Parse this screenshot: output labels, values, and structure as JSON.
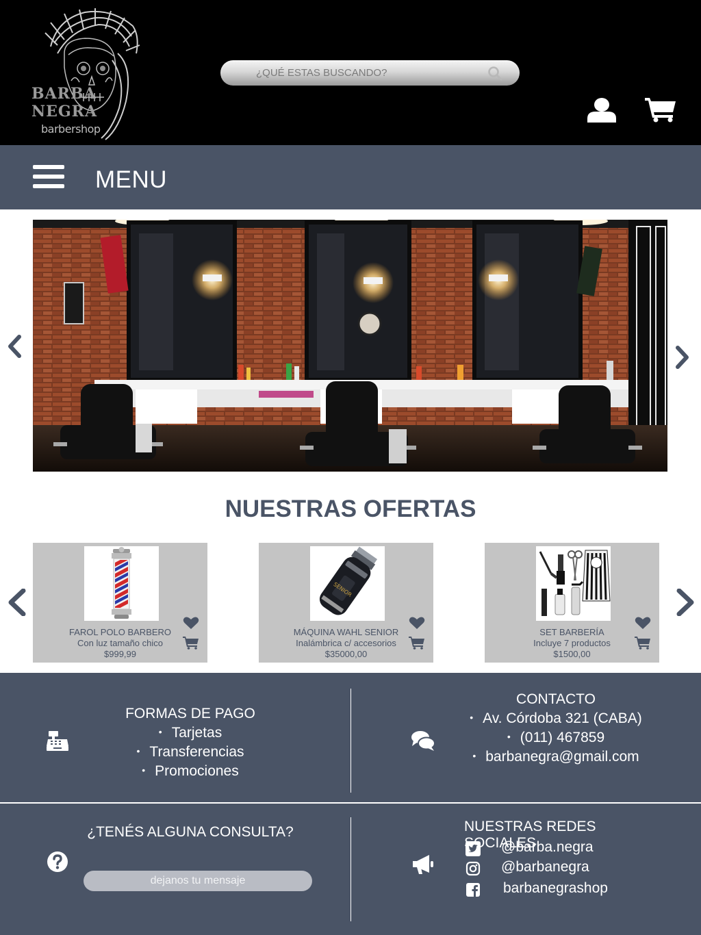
{
  "header": {
    "logo": {
      "line1": "BARBA",
      "line2": "NEGRA",
      "sub": "barbershop"
    },
    "search": {
      "placeholder": "¿QUÉ ESTAS BUSCANDO?"
    },
    "icons": {
      "search": "search-icon",
      "user": "user-icon",
      "cart": "cart-icon"
    }
  },
  "menu": {
    "label": "MENU",
    "icon": "hamburger-icon"
  },
  "hero": {
    "icons": {
      "prev": "chevron-left-icon",
      "next": "chevron-right-icon"
    }
  },
  "ofertas": {
    "title": "NUESTRAS OFERTAS",
    "products": [
      {
        "name": "FAROL POLO BARBERO",
        "desc": "Con luz tamaño chico",
        "price": "$999,99"
      },
      {
        "name": "MÁQUINA WAHL SENIOR",
        "desc": "Inalámbrica c/ accesorios",
        "price": "$35000,00"
      },
      {
        "name": "SET BARBERÍA",
        "desc": "Incluye 7 productos",
        "price": "$1500,00"
      }
    ]
  },
  "footer": {
    "pago": {
      "title": "FORMAS DE PAGO",
      "items": [
        "Tarjetas",
        "Transferencias",
        "Promociones"
      ],
      "icon": "cash-register-icon"
    },
    "contacto": {
      "title": "CONTACTO",
      "items": [
        "Av. Córdoba 321 (CABA)",
        "(011) 467859",
        "barbanegra@gmail.com"
      ],
      "icon": "chat-bubbles-icon"
    },
    "consulta": {
      "title": "¿TENÉS ALGUNA CONSULTA?",
      "placeholder": "dejanos tu mensaje",
      "icon": "question-circle-icon"
    },
    "redes": {
      "title": "NUESTRAS REDES SOCIALES",
      "icon": "megaphone-icon",
      "items": [
        {
          "icon": "twitter-icon",
          "label": "@barba.negra"
        },
        {
          "icon": "instagram-icon",
          "label": "@barbanegra"
        },
        {
          "icon": "facebook-icon",
          "label": "barbanegrashop"
        }
      ]
    }
  },
  "colors": {
    "header_bg": "#000000",
    "bar_bg": "#4a5466",
    "card_bg": "#c4c4c4",
    "accent": "#4a5466",
    "text_light": "#ffffff"
  }
}
